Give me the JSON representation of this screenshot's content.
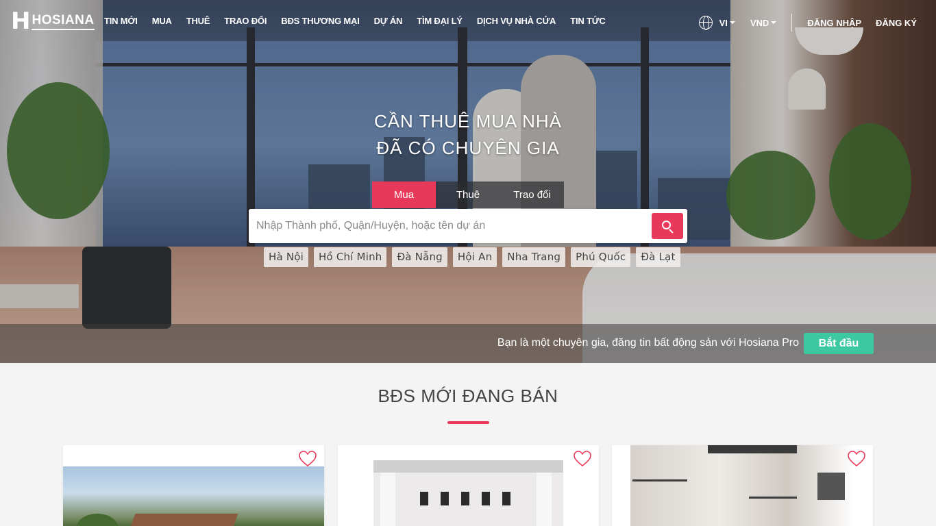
{
  "brand": {
    "logo_mark": "H",
    "logo_text": "HOSIANA"
  },
  "nav": {
    "menu": [
      "TIN MỚI",
      "MUA",
      "THUÊ",
      "TRAO ĐỔI",
      "BĐS THƯƠNG MẠI",
      "DỰ ÁN",
      "TÌM ĐẠI LÝ",
      "DỊCH VỤ NHÀ CỬA",
      "TIN TỨC"
    ],
    "language": "VI",
    "currency": "VND",
    "login": "ĐĂNG NHẬP",
    "register": "ĐĂNG KÝ",
    "language_icon": "globe-icon"
  },
  "hero": {
    "title_line1": "CẦN THUÊ MUA NHÀ",
    "title_line2": "ĐÃ CÓ CHUYÊN GIA",
    "tabs": [
      "Mua",
      "Thuê",
      "Trao đổi"
    ],
    "active_tab": "Mua",
    "search_placeholder": "Nhập Thành phố, Quận/Huyện, hoặc tên dự án",
    "search_icon": "search-icon",
    "cities": [
      "Hà Nội",
      "Hồ Chí Minh",
      "Đà Nẵng",
      "Hội An",
      "Nha Trang",
      "Phú Quốc",
      "Đà Lạt"
    ],
    "pro_text": "Bạn là một chuyên gia, đăng tin bất động sản với Hosiana Pro",
    "pro_button": "Bắt đầu"
  },
  "section": {
    "title": "BĐS MỚI ĐANG BÁN"
  },
  "cards": [
    {
      "favorite_icon": "heart-icon"
    },
    {
      "favorite_icon": "heart-icon"
    },
    {
      "favorite_icon": "heart-icon"
    }
  ],
  "colors": {
    "accent": "#e8395b",
    "pro_button": "#3cc8a0",
    "page_bg": "#f4f4f4"
  }
}
